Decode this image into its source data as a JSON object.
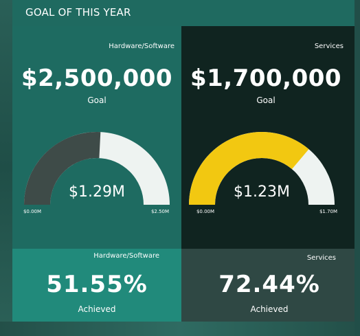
{
  "header": {
    "title": "GOAL OF THIS YEAR"
  },
  "hardware_software": {
    "category": "Hardware/Software",
    "goal_value": "$2,500,000",
    "goal_label": "Goal",
    "gauge_value_label": "$1.29M",
    "gauge_min_label": "$0.00M",
    "gauge_max_label": "$2.50M",
    "pct_category": "Hardware/Software",
    "pct_value": "51.55%",
    "pct_label": "Achieved"
  },
  "services": {
    "category": "Services",
    "goal_value": "$1,700,000",
    "goal_label": "Goal",
    "gauge_value_label": "$1.23M",
    "gauge_min_label": "$0.00M",
    "gauge_max_label": "$1.70M",
    "pct_category": "Services",
    "pct_value": "72.44%",
    "pct_label": "Achieved"
  },
  "chart_data": [
    {
      "type": "gauge",
      "name": "Hardware/Software",
      "value": 1.29,
      "min": 0,
      "max": 2.5,
      "unit": "$M",
      "colors": {
        "fill": "#3e4b48",
        "track": "#eef3f1"
      }
    },
    {
      "type": "gauge",
      "name": "Services",
      "value": 1.23,
      "min": 0,
      "max": 1.7,
      "unit": "$M",
      "colors": {
        "fill": "#f2c811",
        "track": "#eef3f1"
      }
    }
  ]
}
